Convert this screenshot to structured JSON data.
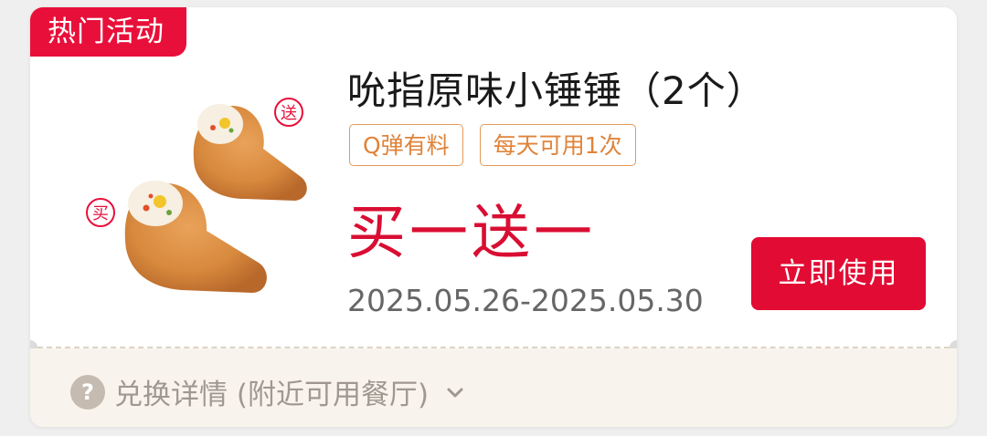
{
  "card": {
    "hot_tag": "热门活动",
    "title": "吮指原味小锤锤（2个）",
    "tags": [
      "Q弹有料",
      "每天可用1次"
    ],
    "promo": "买一送一",
    "validity": "2025.05.26-2025.05.30",
    "use_button": "立即使用",
    "image_badges": {
      "buy": "买",
      "gift": "送"
    },
    "details": {
      "icon_text": "?",
      "label": "兑换详情 (附近可用餐厅)"
    }
  },
  "colors": {
    "brand_red": "#e20b33",
    "tag_orange": "#e39a57",
    "footer_bg": "#f8f4ed"
  },
  "icons": [
    "question-icon",
    "chevron-down-icon"
  ]
}
